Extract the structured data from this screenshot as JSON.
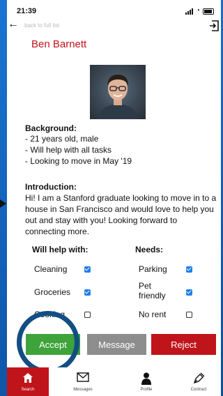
{
  "status": {
    "time": "21:39"
  },
  "nav": {
    "back_label": "back to full list"
  },
  "profile": {
    "name": "Ben Barnett"
  },
  "background": {
    "title": "Background:",
    "items": [
      "- 21 years old, male",
      "- Will help with all tasks",
      "- Looking to move in May '19"
    ]
  },
  "introduction": {
    "title": "Introduction:",
    "text": "Hi! I am a Stanford graduate looking to move in to a house in San Francisco and would love to help you out and stay with you! Looking forward to connecting more."
  },
  "help": {
    "title": "Will help with:",
    "items": [
      {
        "label": "Cleaning",
        "checked": true
      },
      {
        "label": "Groceries",
        "checked": true
      },
      {
        "label": "Cooking",
        "checked": false
      }
    ]
  },
  "needs": {
    "title": "Needs:",
    "items": [
      {
        "label": "Parking",
        "checked": true
      },
      {
        "label": "Pet friendly",
        "checked": true
      },
      {
        "label": "No rent",
        "checked": false
      }
    ]
  },
  "actions": {
    "accept": "Accept",
    "message": "Message",
    "reject": "Reject"
  },
  "tabs": [
    {
      "label": "Search",
      "icon": "home-icon",
      "active": true
    },
    {
      "label": "Messages",
      "icon": "envelope-icon",
      "active": false
    },
    {
      "label": "Profile",
      "icon": "person-icon",
      "active": false
    },
    {
      "label": "Contract",
      "icon": "pen-icon",
      "active": false
    }
  ],
  "colors": {
    "brand_red": "#c0141b",
    "accept_green": "#3ea33a",
    "message_gray": "#8d8d8d",
    "checkbox_blue": "#1f7ee8",
    "ring_navy": "#124e84",
    "background_blue": "#1a74d0"
  }
}
